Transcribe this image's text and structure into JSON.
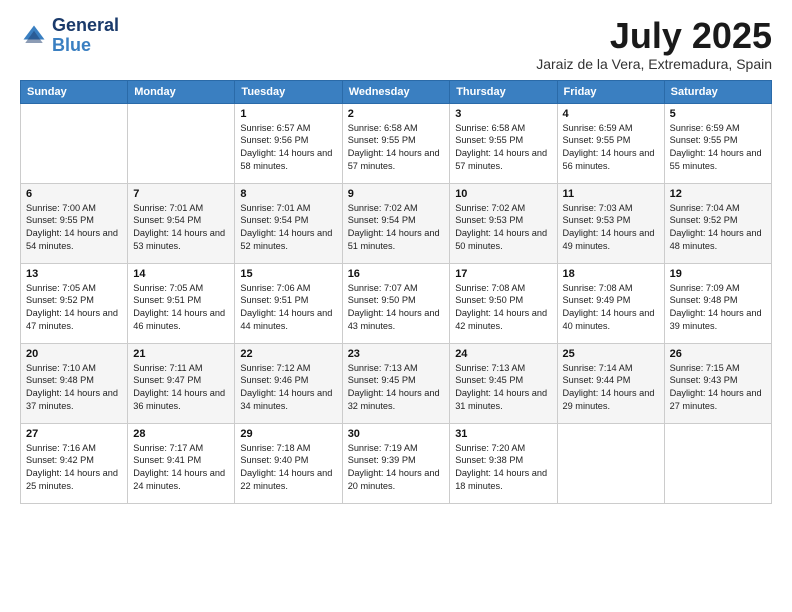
{
  "header": {
    "logo_line1": "General",
    "logo_line2": "Blue",
    "title": "July 2025",
    "subtitle": "Jaraiz de la Vera, Extremadura, Spain"
  },
  "days_of_week": [
    "Sunday",
    "Monday",
    "Tuesday",
    "Wednesday",
    "Thursday",
    "Friday",
    "Saturday"
  ],
  "weeks": [
    [
      {
        "day": "",
        "info": ""
      },
      {
        "day": "",
        "info": ""
      },
      {
        "day": "1",
        "info": "Sunrise: 6:57 AM\nSunset: 9:56 PM\nDaylight: 14 hours and 58 minutes."
      },
      {
        "day": "2",
        "info": "Sunrise: 6:58 AM\nSunset: 9:55 PM\nDaylight: 14 hours and 57 minutes."
      },
      {
        "day": "3",
        "info": "Sunrise: 6:58 AM\nSunset: 9:55 PM\nDaylight: 14 hours and 57 minutes."
      },
      {
        "day": "4",
        "info": "Sunrise: 6:59 AM\nSunset: 9:55 PM\nDaylight: 14 hours and 56 minutes."
      },
      {
        "day": "5",
        "info": "Sunrise: 6:59 AM\nSunset: 9:55 PM\nDaylight: 14 hours and 55 minutes."
      }
    ],
    [
      {
        "day": "6",
        "info": "Sunrise: 7:00 AM\nSunset: 9:55 PM\nDaylight: 14 hours and 54 minutes."
      },
      {
        "day": "7",
        "info": "Sunrise: 7:01 AM\nSunset: 9:54 PM\nDaylight: 14 hours and 53 minutes."
      },
      {
        "day": "8",
        "info": "Sunrise: 7:01 AM\nSunset: 9:54 PM\nDaylight: 14 hours and 52 minutes."
      },
      {
        "day": "9",
        "info": "Sunrise: 7:02 AM\nSunset: 9:54 PM\nDaylight: 14 hours and 51 minutes."
      },
      {
        "day": "10",
        "info": "Sunrise: 7:02 AM\nSunset: 9:53 PM\nDaylight: 14 hours and 50 minutes."
      },
      {
        "day": "11",
        "info": "Sunrise: 7:03 AM\nSunset: 9:53 PM\nDaylight: 14 hours and 49 minutes."
      },
      {
        "day": "12",
        "info": "Sunrise: 7:04 AM\nSunset: 9:52 PM\nDaylight: 14 hours and 48 minutes."
      }
    ],
    [
      {
        "day": "13",
        "info": "Sunrise: 7:05 AM\nSunset: 9:52 PM\nDaylight: 14 hours and 47 minutes."
      },
      {
        "day": "14",
        "info": "Sunrise: 7:05 AM\nSunset: 9:51 PM\nDaylight: 14 hours and 46 minutes."
      },
      {
        "day": "15",
        "info": "Sunrise: 7:06 AM\nSunset: 9:51 PM\nDaylight: 14 hours and 44 minutes."
      },
      {
        "day": "16",
        "info": "Sunrise: 7:07 AM\nSunset: 9:50 PM\nDaylight: 14 hours and 43 minutes."
      },
      {
        "day": "17",
        "info": "Sunrise: 7:08 AM\nSunset: 9:50 PM\nDaylight: 14 hours and 42 minutes."
      },
      {
        "day": "18",
        "info": "Sunrise: 7:08 AM\nSunset: 9:49 PM\nDaylight: 14 hours and 40 minutes."
      },
      {
        "day": "19",
        "info": "Sunrise: 7:09 AM\nSunset: 9:48 PM\nDaylight: 14 hours and 39 minutes."
      }
    ],
    [
      {
        "day": "20",
        "info": "Sunrise: 7:10 AM\nSunset: 9:48 PM\nDaylight: 14 hours and 37 minutes."
      },
      {
        "day": "21",
        "info": "Sunrise: 7:11 AM\nSunset: 9:47 PM\nDaylight: 14 hours and 36 minutes."
      },
      {
        "day": "22",
        "info": "Sunrise: 7:12 AM\nSunset: 9:46 PM\nDaylight: 14 hours and 34 minutes."
      },
      {
        "day": "23",
        "info": "Sunrise: 7:13 AM\nSunset: 9:45 PM\nDaylight: 14 hours and 32 minutes."
      },
      {
        "day": "24",
        "info": "Sunrise: 7:13 AM\nSunset: 9:45 PM\nDaylight: 14 hours and 31 minutes."
      },
      {
        "day": "25",
        "info": "Sunrise: 7:14 AM\nSunset: 9:44 PM\nDaylight: 14 hours and 29 minutes."
      },
      {
        "day": "26",
        "info": "Sunrise: 7:15 AM\nSunset: 9:43 PM\nDaylight: 14 hours and 27 minutes."
      }
    ],
    [
      {
        "day": "27",
        "info": "Sunrise: 7:16 AM\nSunset: 9:42 PM\nDaylight: 14 hours and 25 minutes."
      },
      {
        "day": "28",
        "info": "Sunrise: 7:17 AM\nSunset: 9:41 PM\nDaylight: 14 hours and 24 minutes."
      },
      {
        "day": "29",
        "info": "Sunrise: 7:18 AM\nSunset: 9:40 PM\nDaylight: 14 hours and 22 minutes."
      },
      {
        "day": "30",
        "info": "Sunrise: 7:19 AM\nSunset: 9:39 PM\nDaylight: 14 hours and 20 minutes."
      },
      {
        "day": "31",
        "info": "Sunrise: 7:20 AM\nSunset: 9:38 PM\nDaylight: 14 hours and 18 minutes."
      },
      {
        "day": "",
        "info": ""
      },
      {
        "day": "",
        "info": ""
      }
    ]
  ]
}
